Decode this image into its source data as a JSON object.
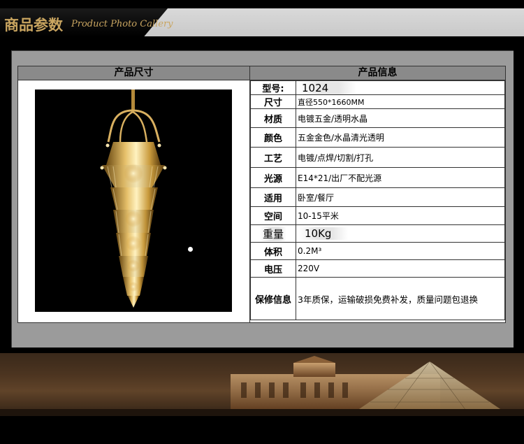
{
  "banner": {
    "title_cn": "商品参数",
    "title_en": "Product Photo Callery"
  },
  "headers": {
    "left": "产品尺寸",
    "right": "产品信息"
  },
  "specs": [
    {
      "key": "型号:",
      "value": "1024"
    },
    {
      "key": "尺寸",
      "value": "直径550*1660MM"
    },
    {
      "key": "材质",
      "value": "电镀五金/透明水晶"
    },
    {
      "key": "颜色",
      "value": "五金金色/水晶清光透明"
    },
    {
      "key": "工艺",
      "value": "电镀/点焊/切割/打孔"
    },
    {
      "key": "光源",
      "value": "E14*21/出厂不配光源"
    },
    {
      "key": "适用",
      "value": "卧室/餐厅"
    },
    {
      "key": "空间",
      "value": "10-15平米"
    },
    {
      "key": "重量",
      "value": "10Kg"
    },
    {
      "key": "体积",
      "value": "0.2M³"
    },
    {
      "key": "电压",
      "value": "220V"
    },
    {
      "key": "保修信息",
      "value": "3年质保，运输破损免费补发，质量问题包退换"
    }
  ],
  "colors": {
    "gold": "#c9a560",
    "panel": "#9b9b9b",
    "header": "#8a8a8a"
  }
}
